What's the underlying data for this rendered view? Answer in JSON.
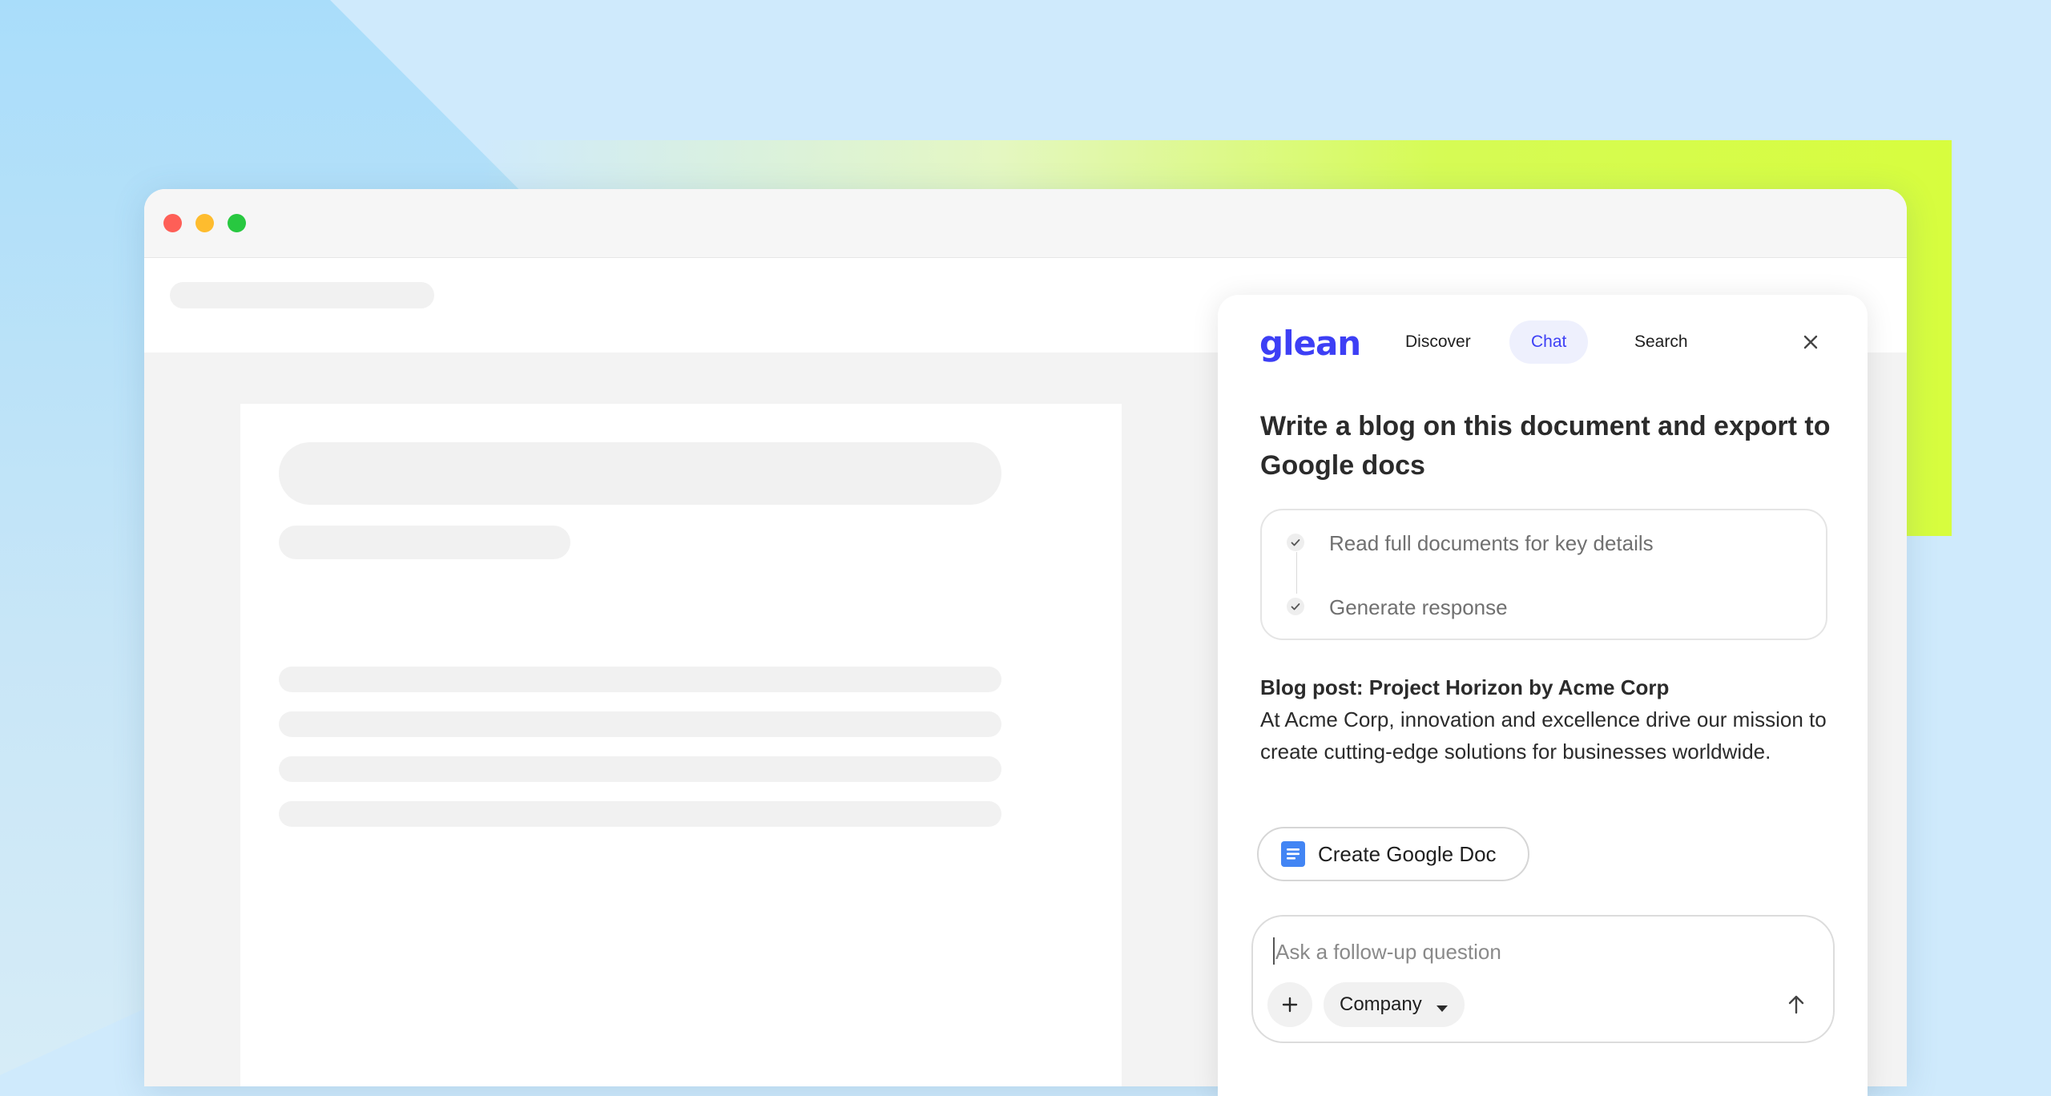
{
  "panel": {
    "logo": "glean",
    "tabs": [
      {
        "label": "Discover",
        "active": false
      },
      {
        "label": "Chat",
        "active": true
      },
      {
        "label": "Search",
        "active": false
      }
    ],
    "close_icon": "close-icon",
    "question": "Write a blog on this document and export to Google docs",
    "steps": [
      {
        "label": "Read full documents for key details",
        "status": "done"
      },
      {
        "label": "Generate response",
        "status": "done"
      }
    ],
    "answer_title": "Blog post: Project Horizon by Acme Corp",
    "answer_body": "At Acme Corp, innovation and excellence drive our mission to create cutting-edge solutions for businesses worldwide.",
    "create_button_label": "Create Google Doc",
    "create_button_icon": "google-docs-icon",
    "followup_placeholder": "Ask a follow-up question",
    "scope_label": "Company",
    "plus_icon": "plus-icon",
    "send_icon": "arrow-up-icon"
  },
  "colors": {
    "brand": "#3d3ff5",
    "active_tab_bg": "#eef0fd",
    "lime_accent": "#d7fd3e",
    "sky_background": "#cfeafc"
  }
}
